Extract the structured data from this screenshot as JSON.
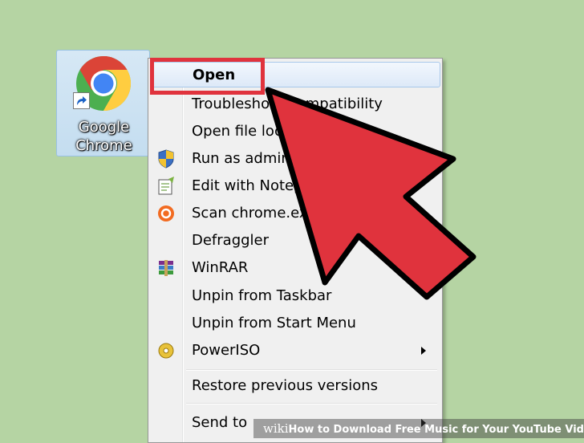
{
  "desktop_icon": {
    "label": "Google\nChrome"
  },
  "context_menu": {
    "items": [
      {
        "label": "Open",
        "icon": null,
        "default": true,
        "submenu": false
      },
      {
        "label": "Troubleshoot compatibility",
        "icon": null,
        "default": false,
        "submenu": false
      },
      {
        "label": "Open file location",
        "icon": null,
        "default": false,
        "submenu": false
      },
      {
        "label": "Run as administrator",
        "icon": "uac-shield-icon",
        "default": false,
        "submenu": false
      },
      {
        "label": "Edit with Notepad++",
        "icon": "notepad-plus-plus-icon",
        "default": false,
        "submenu": false
      },
      {
        "label": "Scan chrome.exe",
        "icon": "avast-icon",
        "default": false,
        "submenu": false
      },
      {
        "label": "Defraggler",
        "icon": null,
        "default": false,
        "submenu": true
      },
      {
        "label": "WinRAR",
        "icon": "winrar-icon",
        "default": false,
        "submenu": true
      },
      {
        "label": "Unpin from Taskbar",
        "icon": null,
        "default": false,
        "submenu": false
      },
      {
        "label": "Unpin from Start Menu",
        "icon": null,
        "default": false,
        "submenu": false
      },
      {
        "label": "PowerISO",
        "icon": "poweriso-icon",
        "default": false,
        "submenu": true
      },
      {
        "label": "Restore previous versions",
        "icon": null,
        "default": false,
        "submenu": false
      },
      {
        "label": "Send to",
        "icon": null,
        "default": false,
        "submenu": true
      }
    ]
  },
  "annotation": {
    "highlight_color": "#e0333d",
    "arrow_color": "#e0333d"
  },
  "watermark": {
    "wiki": "wiki",
    "how": "How",
    "title": " to Download Free Music for Your YouTube Videos"
  }
}
